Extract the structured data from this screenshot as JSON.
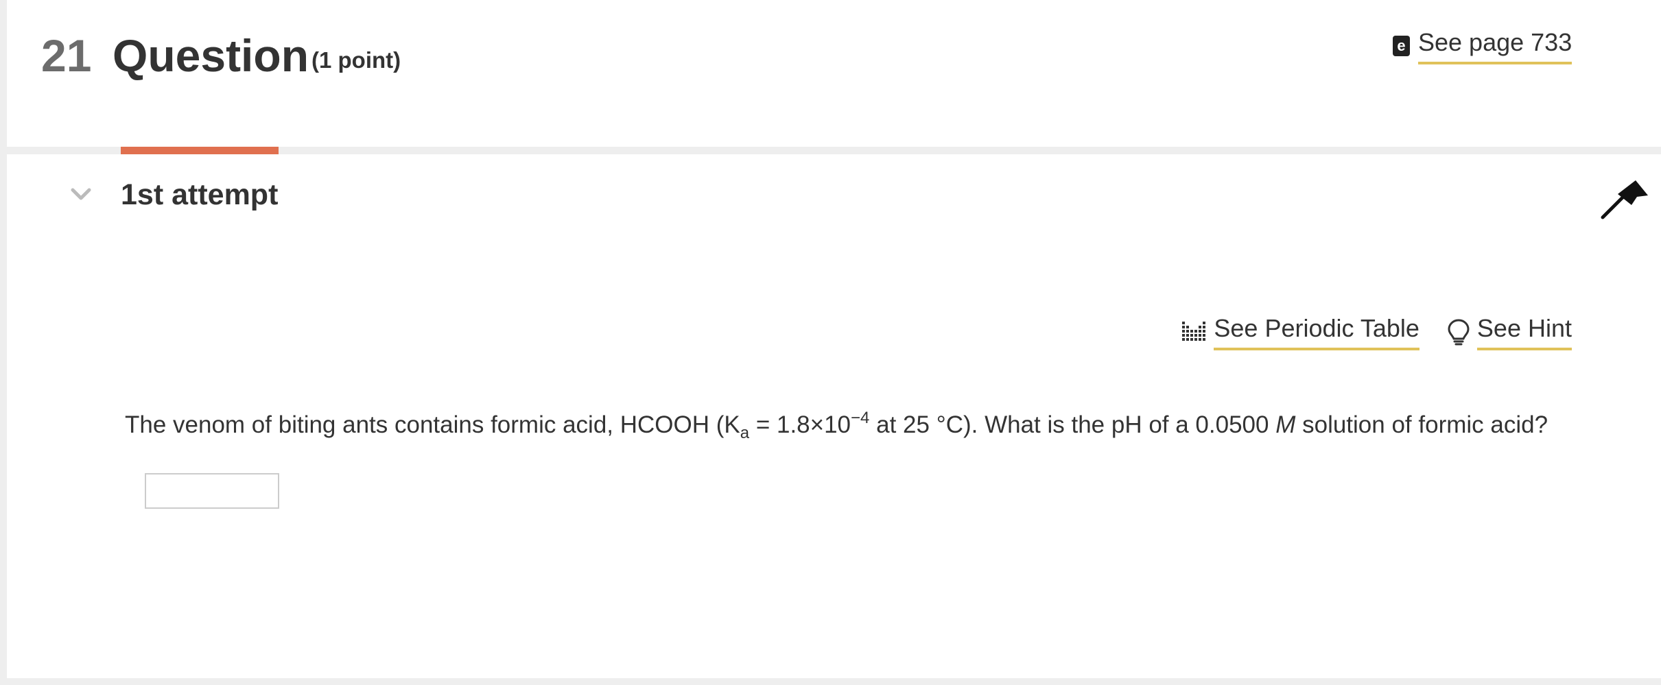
{
  "question": {
    "number": "21",
    "title": "Question",
    "points": "(1 point)"
  },
  "ebook": {
    "icon": "ebook-icon",
    "label": "See page 733"
  },
  "attempt": {
    "label": "1st attempt",
    "expand_icon": "chevron-down-icon",
    "flag_icon": "flag-icon"
  },
  "tools": {
    "periodic_table": {
      "icon": "periodic-table-icon",
      "label": "See Periodic Table"
    },
    "hint": {
      "icon": "lightbulb-icon",
      "label": "See Hint"
    }
  },
  "prompt": {
    "part1": "The venom of biting ants contains formic acid, HCOOH (K",
    "ka_sub": "a",
    "part2": " = 1.8×10",
    "exp": "−4",
    "part3": " at 25 °C). What is the pH of a 0.0500 ",
    "molar": "M",
    "part4": " solution of formic acid?"
  },
  "answer": {
    "value": "",
    "placeholder": ""
  },
  "colors": {
    "accent_underline": "#e0c25a",
    "attempt_indicator": "#e0704f",
    "text": "#333333",
    "number_gray": "#6c6c6c"
  }
}
